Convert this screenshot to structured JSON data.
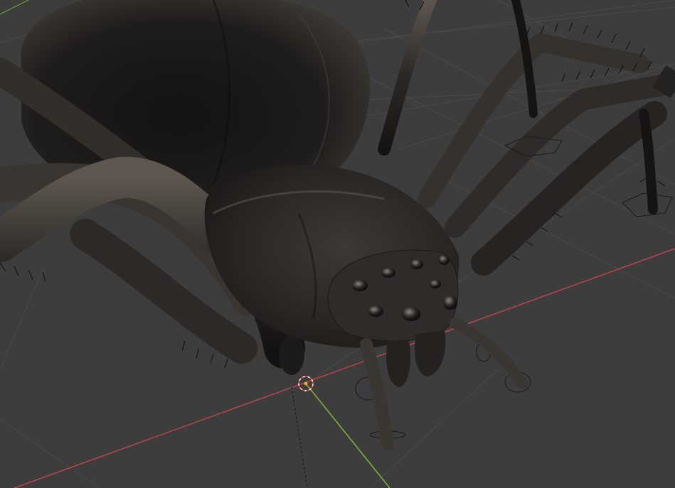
{
  "viewport": {
    "type": "3d-viewport",
    "background_color": "#3d3d3d",
    "grid_color": "#555555",
    "x_axis_color": "#c4444f",
    "y_axis_color": "#7fb02f",
    "model_color": "#2e2a26",
    "model_highlight_color": "#6a625a",
    "hair_color": "#111111",
    "selection_outline_color": "#1c1c1c",
    "cursor_color": "#ffffff",
    "cursor_accent_color": "#e24a4a",
    "origin_color": "#f0b400"
  },
  "scene": {
    "object": "spider",
    "eyes_count": 8,
    "visible_legs": 10
  }
}
